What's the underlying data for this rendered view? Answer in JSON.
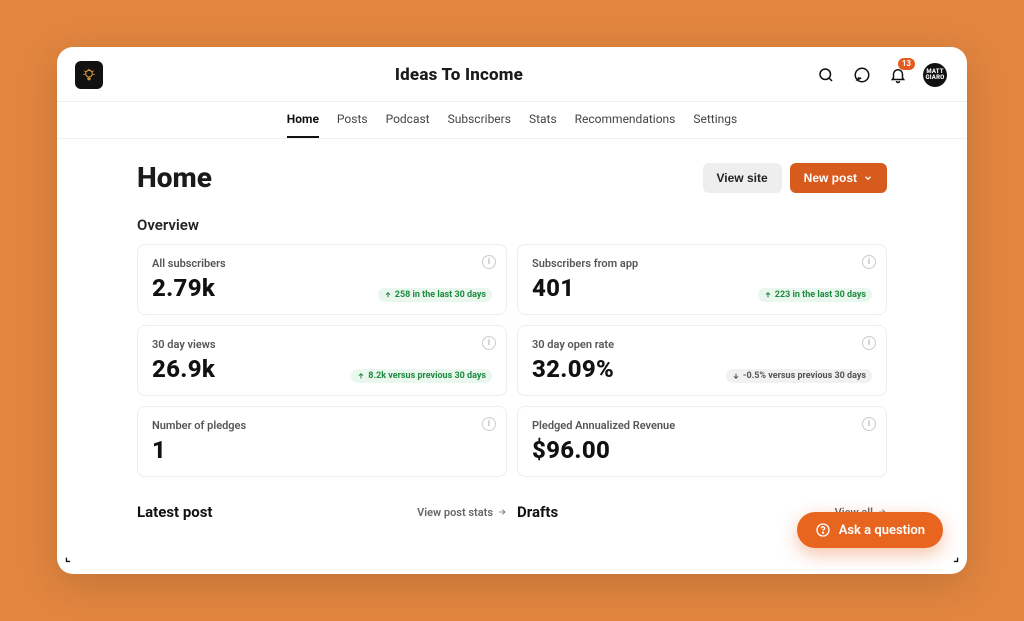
{
  "site_title": "Ideas To Income",
  "tabs": [
    "Home",
    "Posts",
    "Podcast",
    "Subscribers",
    "Stats",
    "Recommendations",
    "Settings"
  ],
  "active_tab": 0,
  "page_title": "Home",
  "header_buttons": {
    "view_site": "View site",
    "new_post": "New post"
  },
  "section_overview": "Overview",
  "avatar_text": "MATT\nGIARO",
  "notification_count": "13",
  "cards": [
    {
      "label": "All subscribers",
      "value": "2.79k",
      "delta": "258 in the last 30 days",
      "dir": "up"
    },
    {
      "label": "Subscribers from app",
      "value": "401",
      "delta": "223 in the last 30 days",
      "dir": "up"
    },
    {
      "label": "30 day views",
      "value": "26.9k",
      "delta": "8.2k versus previous 30 days",
      "dir": "up"
    },
    {
      "label": "30 day open rate",
      "value": "32.09%",
      "delta": "-0.5% versus previous 30 days",
      "dir": "down"
    },
    {
      "label": "Number of pledges",
      "value": "1",
      "delta": null,
      "dir": null
    },
    {
      "label": "Pledged Annualized Revenue",
      "value": "$96.00",
      "delta": null,
      "dir": null
    }
  ],
  "latest_post": {
    "title": "Latest post",
    "link": "View post stats"
  },
  "drafts": {
    "title": "Drafts",
    "link": "View all"
  },
  "ask_button": "Ask a question"
}
